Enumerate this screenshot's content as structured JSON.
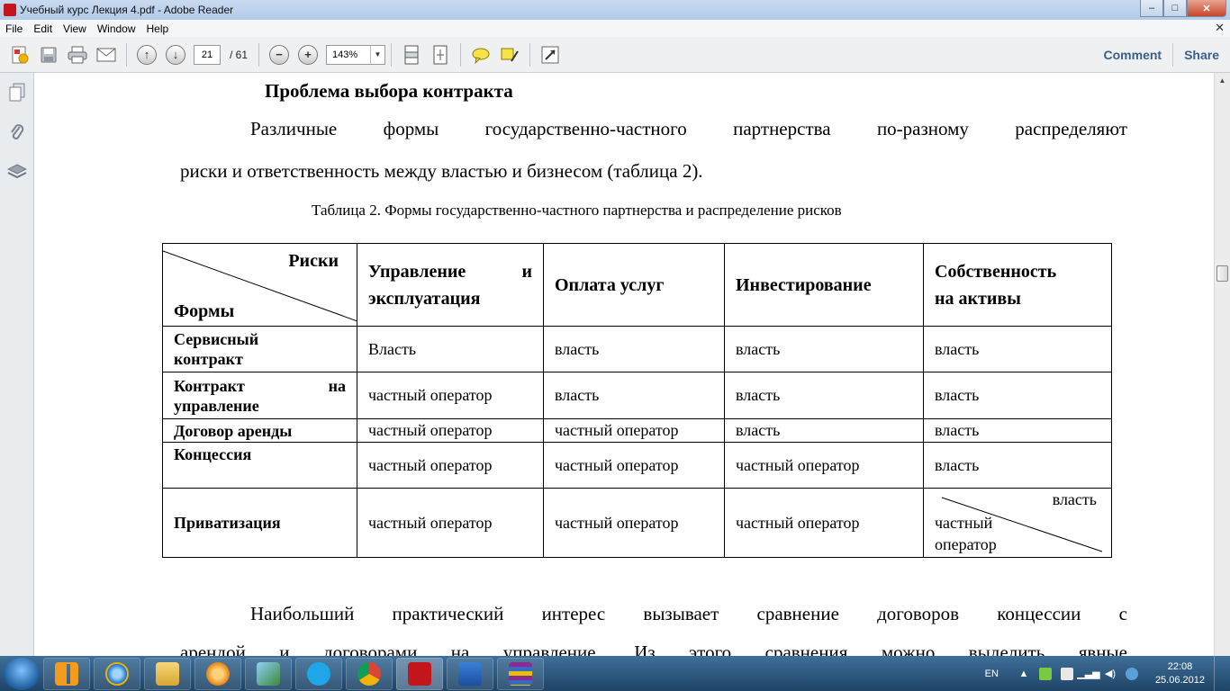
{
  "window": {
    "title": "Учебный курс Лекция 4.pdf - Adobe Reader",
    "controls": {
      "minimize": "–",
      "maximize": "□",
      "close": "✕"
    }
  },
  "menu": {
    "items": [
      "File",
      "Edit",
      "View",
      "Window",
      "Help"
    ],
    "doc_close": "✕"
  },
  "toolbar": {
    "current_page": "21",
    "total_pages": "/ 61",
    "zoom": "143%",
    "comment_label": "Comment",
    "share_label": "Share"
  },
  "document": {
    "heading": "Проблема выбора контракта",
    "para1_line1": [
      "Различные",
      "формы",
      "государственно-частного",
      "партнерства",
      "по-разному",
      "распределяют"
    ],
    "para1_line2": "риски и ответственность между властью и бизнесом (таблица 2).",
    "caption": "Таблица 2. Формы государственно-частного партнерства и распределение рисков",
    "table": {
      "corner_risks": "Риски",
      "corner_forms": "Формы",
      "headers": [
        {
          "line1a": "Управление",
          "line1b": "и",
          "line2": "эксплуатация"
        },
        {
          "line1": "Оплата услуг"
        },
        {
          "line1": "Инвестирование"
        },
        {
          "line1": "Собственность",
          "line2": "на активы"
        }
      ],
      "rows": [
        {
          "form_a": "Сервисный",
          "form_b": "контракт",
          "cells": [
            "Власть",
            "власть",
            "власть",
            "власть"
          ]
        },
        {
          "form_a1": "Контракт",
          "form_a2": "на",
          "form_b": "управление",
          "cells": [
            "частный оператор",
            "власть",
            "власть",
            "власть"
          ]
        },
        {
          "form": "Договор аренды",
          "cells": [
            "частный оператор",
            "частный оператор",
            "власть",
            "власть"
          ]
        },
        {
          "form": "Концессия",
          "cells": [
            "частный оператор",
            "частный оператор",
            "частный оператор",
            "власть"
          ]
        },
        {
          "form": "Приватизация",
          "cells": [
            "частный оператор",
            "частный оператор",
            "частный оператор"
          ],
          "split_top": "власть",
          "split_bottom": "частный оператор"
        }
      ]
    },
    "para2_line1": [
      "Наибольший",
      "практический",
      "интерес",
      "вызывает",
      "сравнение",
      "договоров",
      "концессии",
      "с"
    ],
    "para2_line2": [
      "арендой",
      "и",
      "договорами",
      "на",
      "управление.",
      "Из",
      "этого",
      "сравнения",
      "можно",
      "выделить",
      "явные"
    ]
  },
  "taskbar": {
    "language": "EN",
    "time": "22:08",
    "date": "25.06.2012"
  },
  "colors": {
    "titlebar": "#b3cbe8",
    "toolbar": "#eef0f2",
    "taskbar": "#2a5680",
    "link": "#3a5f8a"
  }
}
